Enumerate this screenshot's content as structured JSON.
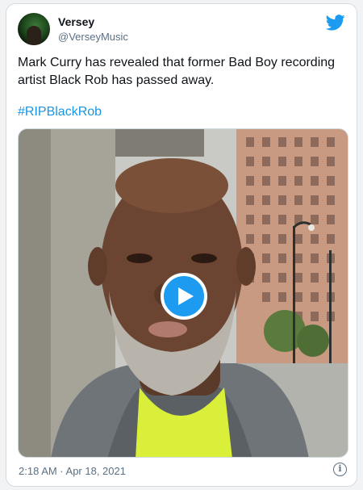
{
  "author": {
    "name": "Versey",
    "handle": "@VerseyMusic"
  },
  "tweet": {
    "text": "Mark Curry has revealed that former Bad Boy recording artist Black Rob has passed away.",
    "hashtag": "#RIPBlackRob",
    "timestamp": "2:18 AM · Apr 18, 2021"
  },
  "media": {
    "type": "video",
    "play_icon": "play-icon"
  },
  "icons": {
    "brand": "twitter-bird-icon",
    "info": "info-icon"
  },
  "colors": {
    "accent": "#1d9bf0",
    "text": "#0f1419",
    "muted": "#5b7083"
  }
}
